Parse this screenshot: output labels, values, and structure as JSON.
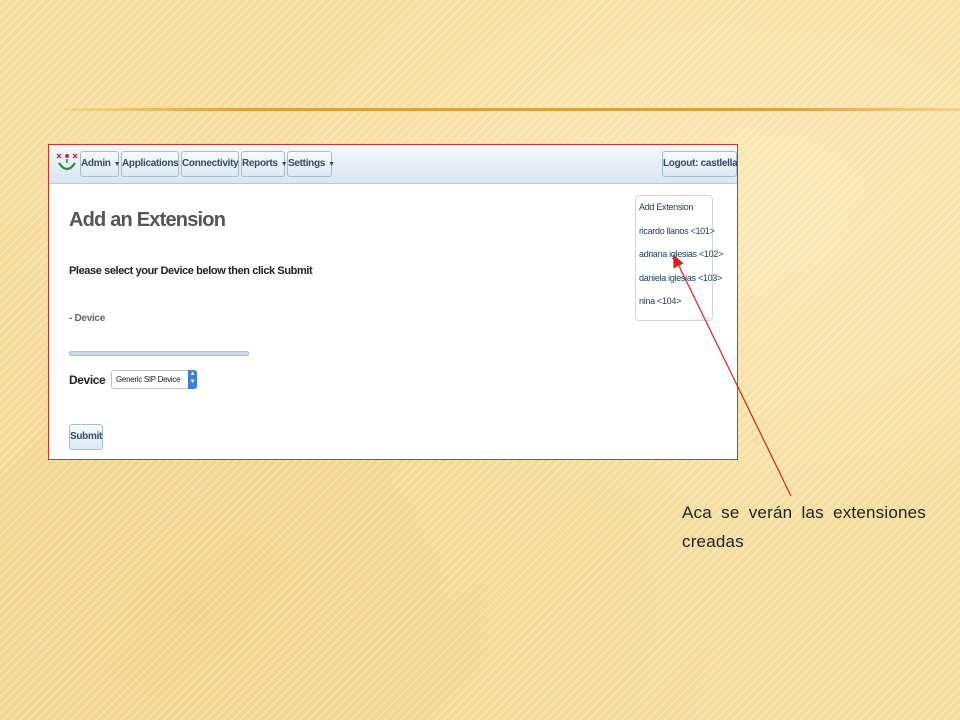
{
  "navbar": {
    "menus": [
      {
        "label": "Admin"
      },
      {
        "label": "Applications"
      },
      {
        "label": "Connectivity"
      },
      {
        "label": "Reports"
      },
      {
        "label": "Settings"
      }
    ],
    "logout_label": "Logout: castlellanos",
    "caret_icon": "chevron-down-icon"
  },
  "main": {
    "title": "Add an Extension",
    "instruction": "Please select your Device below then click Submit",
    "section_label": "- Device",
    "device_label": "Device",
    "device_select_value": "Generic SIP Device",
    "submit_label": "Submit"
  },
  "extensions": {
    "items": [
      "Add Extension",
      "ricardo llanos <101>",
      "adriana iglesias <102>",
      "daniela iglesias <103>",
      "nina <104>"
    ]
  },
  "annotation": {
    "text": "Aca se verán las extensiones creadas",
    "arrow_color": "#e0201b"
  },
  "colors": {
    "border_accent": "#d0312d",
    "nav_text": "#2b4d70"
  }
}
